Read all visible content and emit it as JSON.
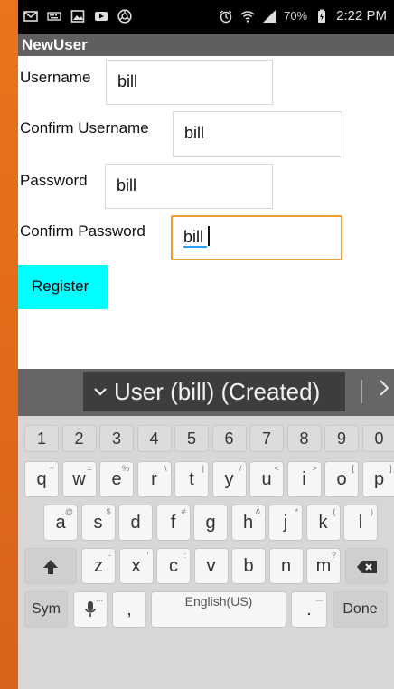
{
  "status_bar": {
    "icons_left": [
      "mail-icon",
      "keyboard-icon",
      "image-icon",
      "video-icon",
      "chrome-icon"
    ],
    "battery_percent": "70%",
    "time": "2:22 PM"
  },
  "app": {
    "title": "NewUser"
  },
  "form": {
    "username_label": "Username",
    "username_value": "bill",
    "confirm_username_label": "Confirm Username",
    "confirm_username_value": "bill",
    "password_label": "Password",
    "password_value": "bill",
    "confirm_password_label": "Confirm Password",
    "confirm_password_value": "bill",
    "register_label": "Register"
  },
  "keyboard": {
    "suggestion": "User (bill) (Created)",
    "number_row": [
      "1",
      "2",
      "3",
      "4",
      "5",
      "6",
      "7",
      "8",
      "9",
      "0"
    ],
    "row1": [
      "q",
      "w",
      "e",
      "r",
      "t",
      "y",
      "u",
      "i",
      "o",
      "p"
    ],
    "row1_hints": [
      "+",
      "=",
      "%",
      "\\",
      "|",
      "/",
      "<",
      ">",
      "[",
      "]"
    ],
    "row2": [
      "a",
      "s",
      "d",
      "f",
      "g",
      "h",
      "j",
      "k",
      "l"
    ],
    "row2_hints": [
      "@",
      "$",
      "",
      "#",
      "",
      "&",
      "*",
      "(",
      ")"
    ],
    "row3": [
      "z",
      "x",
      "c",
      "v",
      "b",
      "n",
      "m"
    ],
    "row3_hints": [
      "-",
      "'",
      ":",
      "",
      "",
      "",
      "?"
    ],
    "sym_label": "Sym",
    "comma_label": ",",
    "space_label": "English(US)",
    "period_label": ".",
    "done_label": "Done"
  }
}
